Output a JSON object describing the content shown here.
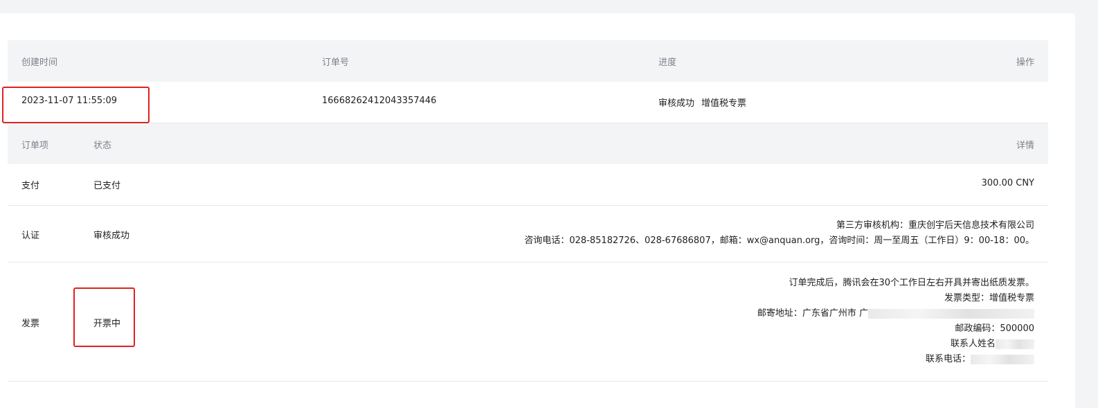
{
  "order_table": {
    "headers": {
      "created": "创建时间",
      "order_no": "订单号",
      "progress": "进度",
      "action": "操作"
    },
    "row": {
      "created": "2023-11-07 11:55:09",
      "order_no": "1666826241204335744​6",
      "status": "审核成功",
      "invoice_kind": "增值税专票"
    }
  },
  "items_table": {
    "headers": {
      "item": "订单项",
      "status": "状态",
      "details": "详情"
    },
    "payment": {
      "item": "支付",
      "status": "已支付",
      "detail": "300.00 CNY"
    },
    "verify": {
      "item": "认证",
      "status": "审核成功",
      "line1": "第三方审核机构：重庆创宇后天信息技术有限公司",
      "line2": "咨询电话：028-85182726、028-67686807，邮箱：wx@anquan.org，咨询时间：周一至周五（工作日）9：00-18：00。"
    },
    "invoice": {
      "item": "发票",
      "status": "开票中",
      "line1": "订单完成后，腾讯会在30个工作日左右开具并寄出纸质发票。",
      "line2": "发票类型：增值税专票",
      "line3": "邮寄地址：广东省广州市 广",
      "line4": "邮政编码：500000",
      "line5": "联系人姓名",
      "line6": "联系电话："
    }
  },
  "colors": {
    "highlight": "#e02020",
    "header_bg": "#f3f4f6",
    "muted_text": "#7d8189"
  }
}
